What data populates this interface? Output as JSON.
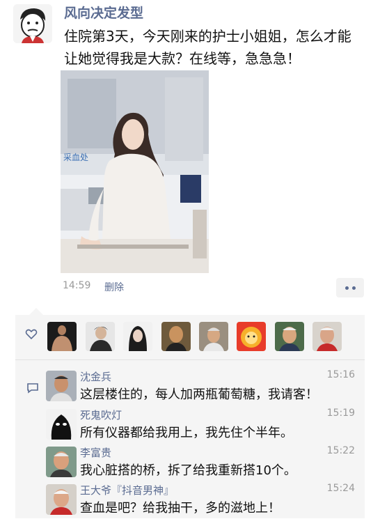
{
  "post": {
    "username": "风向决定发型",
    "text": "住院第3天，今天刚来的护士小姐姐，怎么才能让她觉得我是大款？在线等，急急急！",
    "photo_sign": "采血处",
    "time": "14:59",
    "delete_label": "删除"
  },
  "likes": {
    "avatars": [
      "muscle-man-avatar",
      "man-avatar",
      "long-hair-avatar",
      "bald-man-avatar",
      "old-man-avatar",
      "cartoon-lion-avatar",
      "old-man-avatar-2",
      "old-man-avatar-3"
    ]
  },
  "comments": [
    {
      "name": "沈金兵",
      "time": "15:16",
      "text": "这层楼住的，每人加两瓶葡萄糖，我请客！"
    },
    {
      "name": "死鬼吹灯",
      "time": "15:19",
      "text": "所有仪器都给我用上，我先住个半年。"
    },
    {
      "name": "李富贵",
      "time": "15:22",
      "text": "我心脏搭的桥，拆了给我重新搭10个。"
    },
    {
      "name": "王大爷『抖音男神』",
      "time": "15:24",
      "text": "查血是吧？给我抽干，多的滋地上！"
    }
  ],
  "colors": {
    "link": "#5a6b91",
    "panel": "#f5f5f5",
    "time": "#9a9a9a"
  }
}
